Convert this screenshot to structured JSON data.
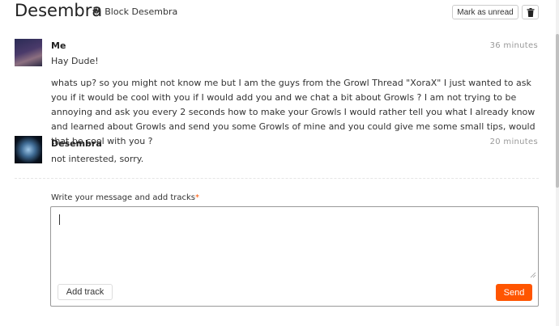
{
  "header": {
    "title": "Desembra",
    "block_glyph": "�",
    "block_label": "Block Desembra",
    "mark_unread_label": "Mark as unread",
    "trash_icon": "trash-icon"
  },
  "messages": [
    {
      "author": "Me",
      "time": "36 minutes",
      "lines": [
        "Hay Dude!",
        "whats up? so you might not know me but I am the guys from the Growl Thread \"XoraX\" I just wanted to ask you if it would be cool with you if I would add you and we chat a bit about Growls ? I am not trying to be annoying and ask you every 2 seconds how to make your Growls I would rather tell you what I already know and learned about Growls and send you some Growls of mine and you could give me some small tips, would that be cool with you ?"
      ]
    },
    {
      "author": "Desembra",
      "time": "20 minutes",
      "lines": [
        "not interested, sorry."
      ]
    }
  ],
  "compose": {
    "label": "Write your message and add tracks",
    "required_marker": "*",
    "value": "",
    "add_track_label": "Add track",
    "send_label": "Send"
  },
  "colors": {
    "accent": "#ff5500",
    "border": "#cccccc",
    "muted_text": "#999999"
  }
}
